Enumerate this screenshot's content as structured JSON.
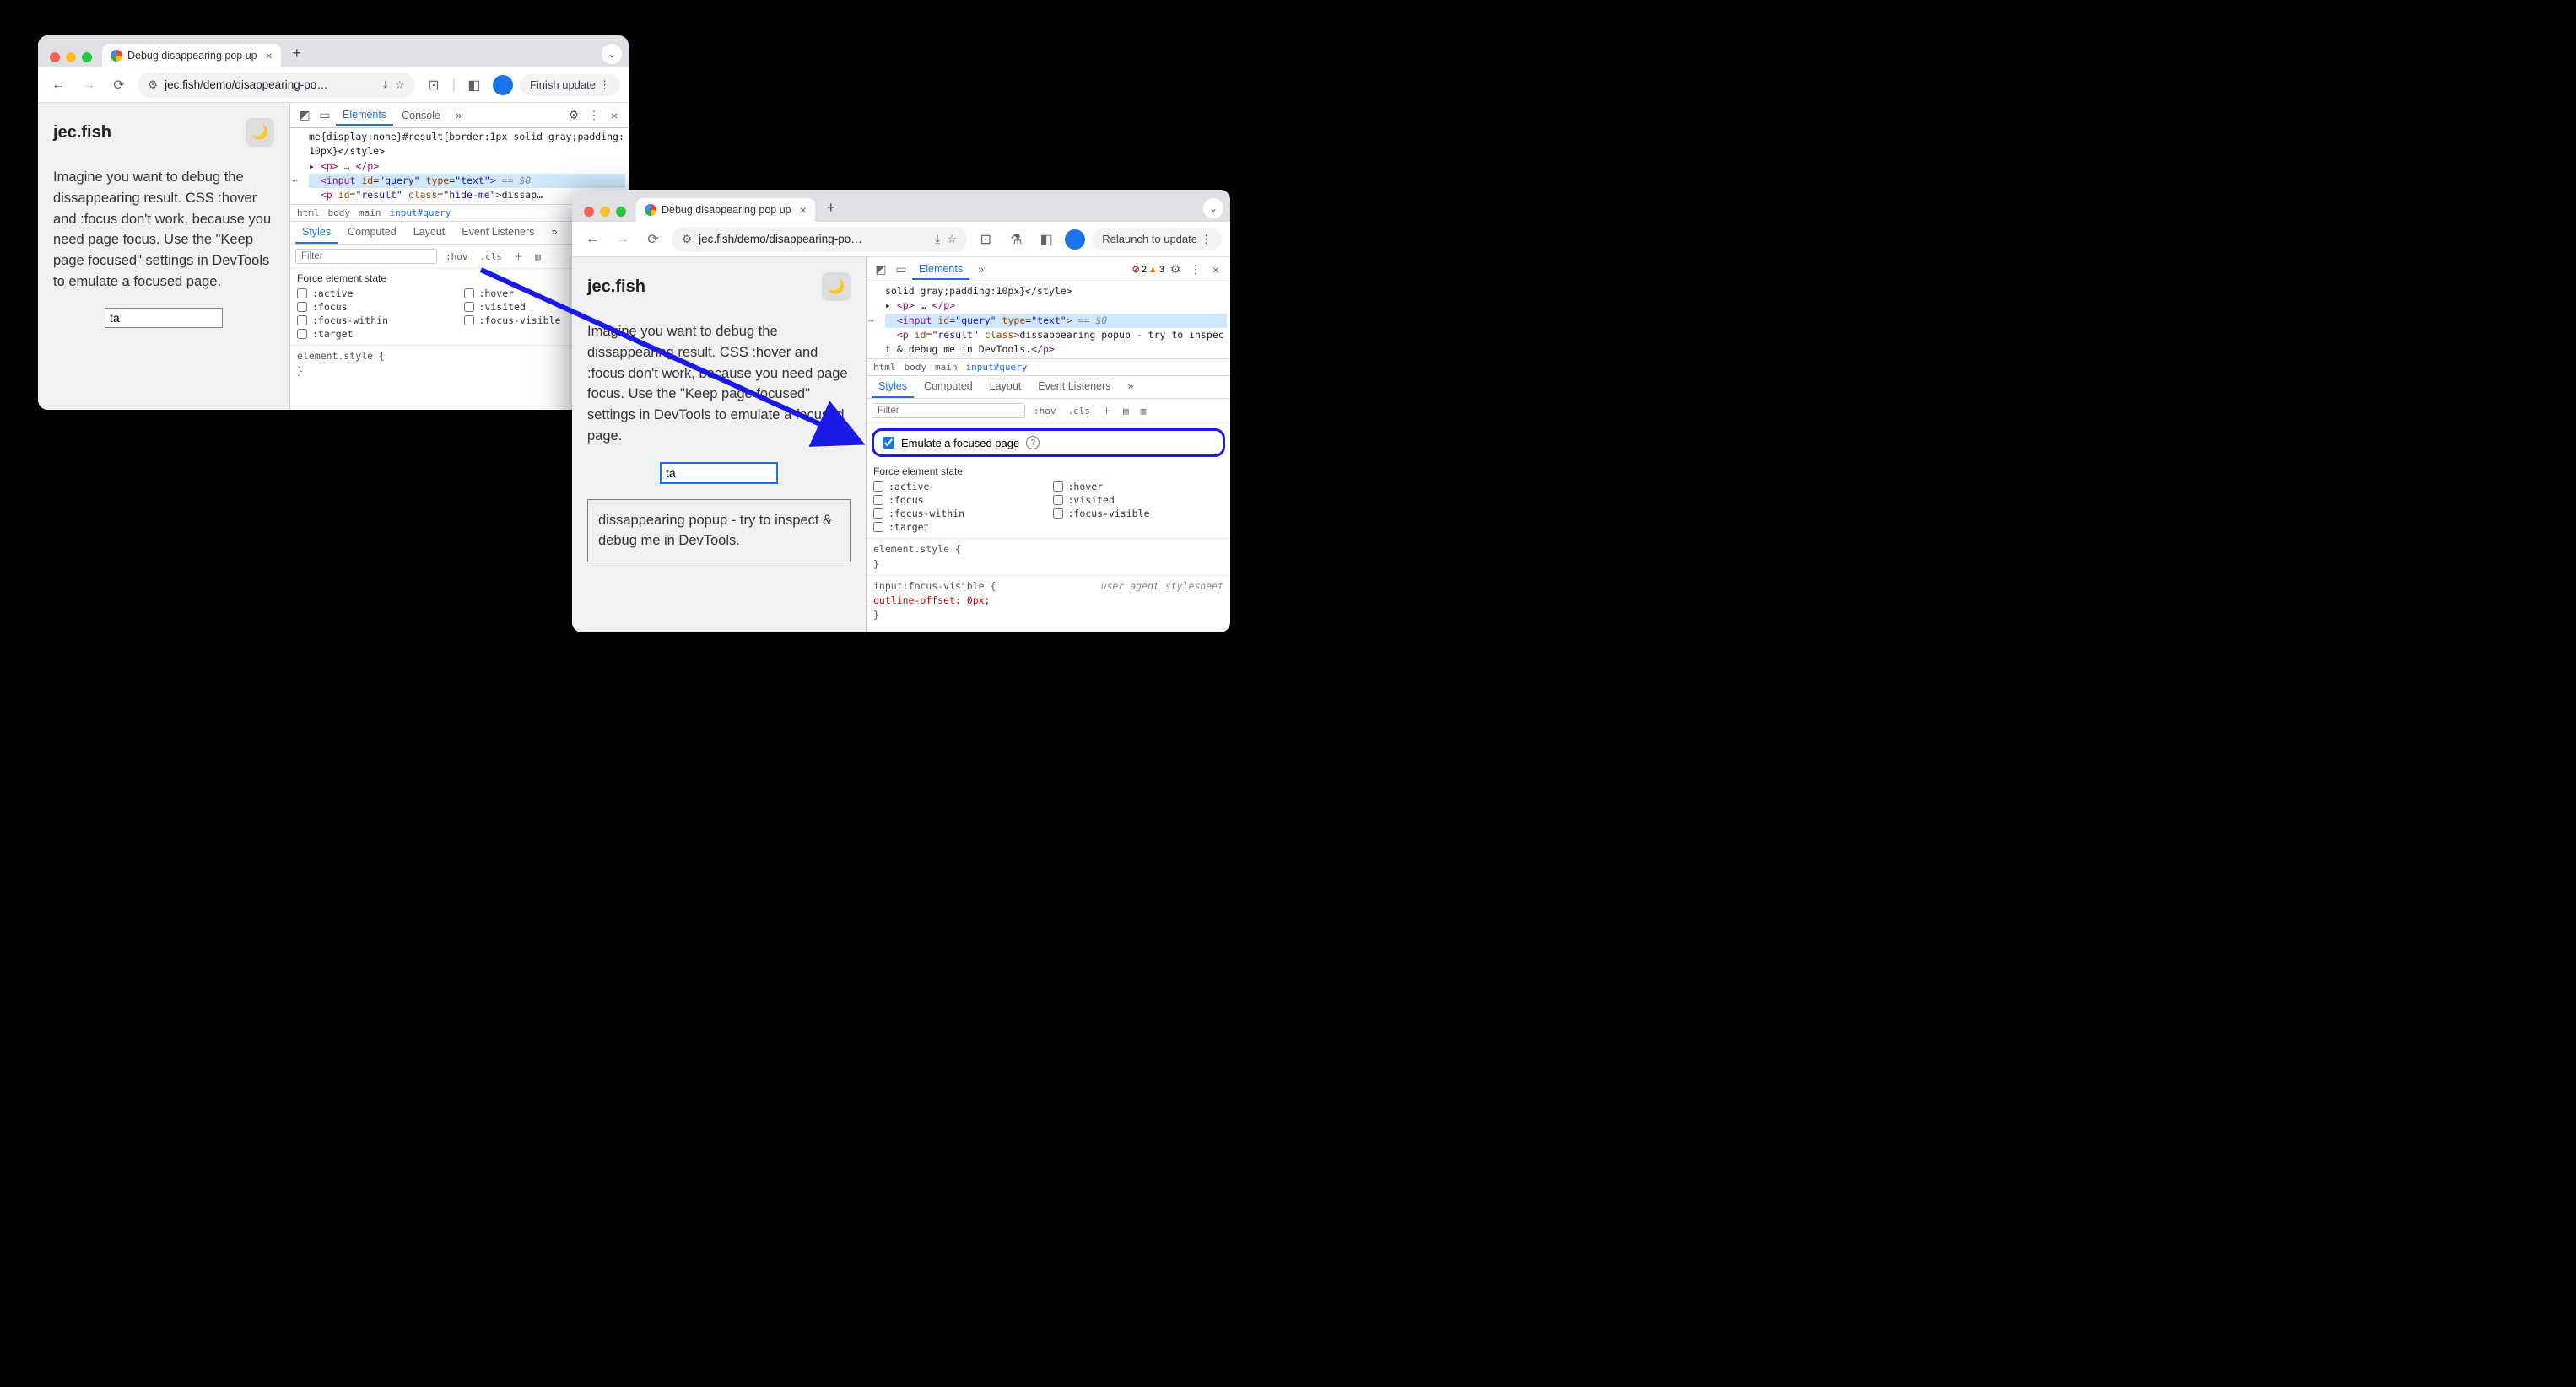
{
  "windows": {
    "a": {
      "tab_title": "Debug disappearing pop up",
      "url_display": "jec.fish/demo/disappearing-po…",
      "update_button": "Finish update",
      "page_heading": "jec.fish",
      "body_text": "Imagine you want to debug the dissappearing result. CSS :hover and :focus don't work, because you need page focus. Use the \"Keep page focused\" settings in DevTools to emulate a focused page.",
      "input_value": "ta",
      "devtools": {
        "tabs": [
          "Elements",
          "Console"
        ],
        "styles_tabs": [
          "Styles",
          "Computed",
          "Layout",
          "Event Listeners"
        ],
        "filter_placeholder": "Filter",
        "hov_label": ":hov",
        "cls_label": ".cls",
        "force_head": "Force element state",
        "force_states": [
          ":active",
          ":hover",
          ":focus",
          ":visited",
          ":focus-within",
          ":focus-visible",
          ":target"
        ],
        "crumbs": [
          "html",
          "body",
          "main",
          "input#query"
        ],
        "code_line1": "me{display:none}#result{border:1px solid gray;padding:10px}</style>",
        "code_line2": "<p> … </p>",
        "code_sel": "<input id=\"query\" type=\"text\"> == $0",
        "code_line3": "<p id=\"result\" class=\"hide-me\">dissap…",
        "css_block": "element.style {\n}"
      }
    },
    "b": {
      "tab_title": "Debug disappearing pop up",
      "url_display": "jec.fish/demo/disappearing-po…",
      "update_button": "Relaunch to update",
      "page_heading": "jec.fish",
      "body_text": "Imagine you want to debug the dissappearing result. CSS :hover and :focus don't work, because you need page focus. Use the \"Keep page focused\" settings in DevTools to emulate a focused page.",
      "input_value": "ta",
      "result_text": "dissappearing popup - try to inspect & debug me in DevTools.",
      "errors": "2",
      "warnings": "3",
      "devtools": {
        "tabs": [
          "Elements"
        ],
        "styles_tabs": [
          "Styles",
          "Computed",
          "Layout",
          "Event Listeners"
        ],
        "filter_placeholder": "Filter",
        "hov_label": ":hov",
        "cls_label": ".cls",
        "emulate_label": "Emulate a focused page",
        "force_head": "Force element state",
        "force_states": [
          ":active",
          ":hover",
          ":focus",
          ":visited",
          ":focus-within",
          ":focus-visible",
          ":target"
        ],
        "crumbs": [
          "html",
          "body",
          "main",
          "input#query"
        ],
        "code_line0": "solid gray;padding:10px}</style>",
        "code_line2": "<p> … </p>",
        "code_sel": "<input id=\"query\" type=\"text\"> == $0",
        "code_line3": "<p id=\"result\" class>dissappearing popup - try to inspect & debug me in DevTools.</p>",
        "css_block1": "element.style {\n}",
        "css_block2_sel": "input:focus-visible {",
        "css_block2_prop": "  outline-offset: 0px;",
        "css_block2_end": "}",
        "css_block2_comment": "user agent stylesheet"
      }
    }
  }
}
